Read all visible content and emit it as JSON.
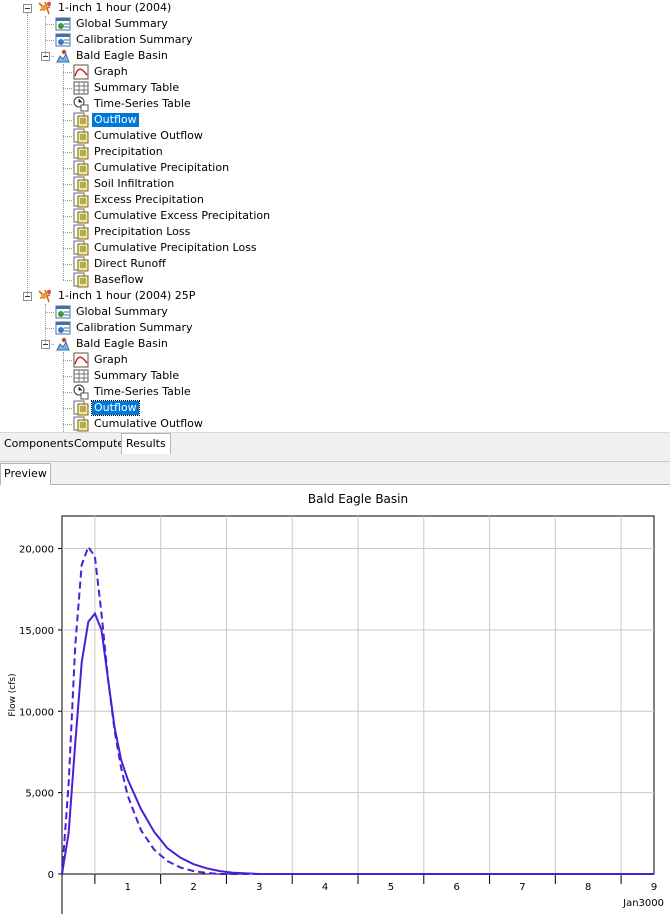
{
  "tree": {
    "items": [
      {
        "label": "1-inch 1 hour (2004)",
        "level": 0,
        "icon": "run-icon",
        "toggle": true
      },
      {
        "label": "Global Summary",
        "level": 1,
        "icon": "global-summary-icon"
      },
      {
        "label": "Calibration Summary",
        "level": 1,
        "icon": "calibration-summary-icon"
      },
      {
        "label": "Bald Eagle Basin",
        "level": 1,
        "icon": "basin-icon",
        "toggle": true
      },
      {
        "label": "Graph",
        "level": 2,
        "icon": "graph-icon"
      },
      {
        "label": "Summary Table",
        "level": 2,
        "icon": "summary-table-icon"
      },
      {
        "label": "Time-Series Table",
        "level": 2,
        "icon": "time-series-icon"
      },
      {
        "label": "Outflow",
        "level": 2,
        "icon": "result-icon",
        "selected": true
      },
      {
        "label": "Cumulative Outflow",
        "level": 2,
        "icon": "result-icon"
      },
      {
        "label": "Precipitation",
        "level": 2,
        "icon": "result-icon"
      },
      {
        "label": "Cumulative Precipitation",
        "level": 2,
        "icon": "result-icon"
      },
      {
        "label": "Soil Infiltration",
        "level": 2,
        "icon": "result-icon"
      },
      {
        "label": "Excess Precipitation",
        "level": 2,
        "icon": "result-icon"
      },
      {
        "label": "Cumulative Excess Precipitation",
        "level": 2,
        "icon": "result-icon"
      },
      {
        "label": "Precipitation Loss",
        "level": 2,
        "icon": "result-icon"
      },
      {
        "label": "Cumulative Precipitation Loss",
        "level": 2,
        "icon": "result-icon"
      },
      {
        "label": "Direct Runoff",
        "level": 2,
        "icon": "result-icon"
      },
      {
        "label": "Baseflow",
        "level": 2,
        "icon": "result-icon"
      },
      {
        "label": "1-inch 1 hour (2004) 25P",
        "level": 0,
        "icon": "run-icon",
        "toggle": true
      },
      {
        "label": "Global Summary",
        "level": 1,
        "icon": "global-summary-icon"
      },
      {
        "label": "Calibration Summary",
        "level": 1,
        "icon": "calibration-summary-icon"
      },
      {
        "label": "Bald Eagle Basin",
        "level": 1,
        "icon": "basin-icon",
        "toggle": true
      },
      {
        "label": "Graph",
        "level": 2,
        "icon": "graph-icon"
      },
      {
        "label": "Summary Table",
        "level": 2,
        "icon": "summary-table-icon"
      },
      {
        "label": "Time-Series Table",
        "level": 2,
        "icon": "time-series-icon"
      },
      {
        "label": "Outflow",
        "level": 2,
        "icon": "result-icon",
        "selected": true
      },
      {
        "label": "Cumulative Outflow",
        "level": 2,
        "icon": "result-icon"
      }
    ]
  },
  "tabs": [
    "Components",
    "Compute",
    "Results"
  ],
  "active_tab": "Results",
  "preview_tab": "Preview",
  "colors": {
    "series": "#4b1fd6",
    "grid": "#c8c8c8",
    "selection": "#0078d7"
  },
  "chart_data": {
    "type": "line",
    "title": "Bald Eagle Basin",
    "ylabel": "Flow (cfs)",
    "xlabel": "Jan3000",
    "x_ticks": [
      "1",
      "2",
      "3",
      "4",
      "5",
      "6",
      "7",
      "8",
      "9"
    ],
    "y_ticks": [
      "0",
      "5,000",
      "10,000",
      "15,000",
      "20,000"
    ],
    "xlim": [
      0,
      9
    ],
    "ylim": [
      0,
      22000
    ],
    "grid": true,
    "series": [
      {
        "style": "solid",
        "x": [
          0,
          0.1,
          0.2,
          0.3,
          0.4,
          0.5,
          0.6,
          0.7,
          0.8,
          0.9,
          1.0,
          1.2,
          1.4,
          1.6,
          1.8,
          2.0,
          2.2,
          2.4,
          2.6,
          3.0,
          4.0,
          5.0,
          6.0,
          7.0,
          8.0,
          9.0
        ],
        "y": [
          0,
          2500,
          8000,
          13000,
          15500,
          16000,
          15000,
          12000,
          9000,
          7000,
          5800,
          4000,
          2600,
          1600,
          1000,
          600,
          350,
          180,
          80,
          0,
          0,
          0,
          0,
          0,
          0,
          0
        ]
      },
      {
        "style": "dashed",
        "x": [
          0,
          0.1,
          0.2,
          0.3,
          0.4,
          0.5,
          0.6,
          0.7,
          0.8,
          0.9,
          1.0,
          1.2,
          1.4,
          1.6,
          1.8,
          2.0,
          2.2,
          2.4,
          3.0,
          4.0,
          5.0,
          6.0,
          7.0,
          8.0,
          9.0
        ],
        "y": [
          0,
          5500,
          14000,
          19000,
          20100,
          19500,
          16000,
          12000,
          8800,
          6500,
          4800,
          2700,
          1500,
          800,
          400,
          180,
          60,
          0,
          0,
          0,
          0,
          0,
          0,
          0,
          0
        ]
      }
    ]
  }
}
